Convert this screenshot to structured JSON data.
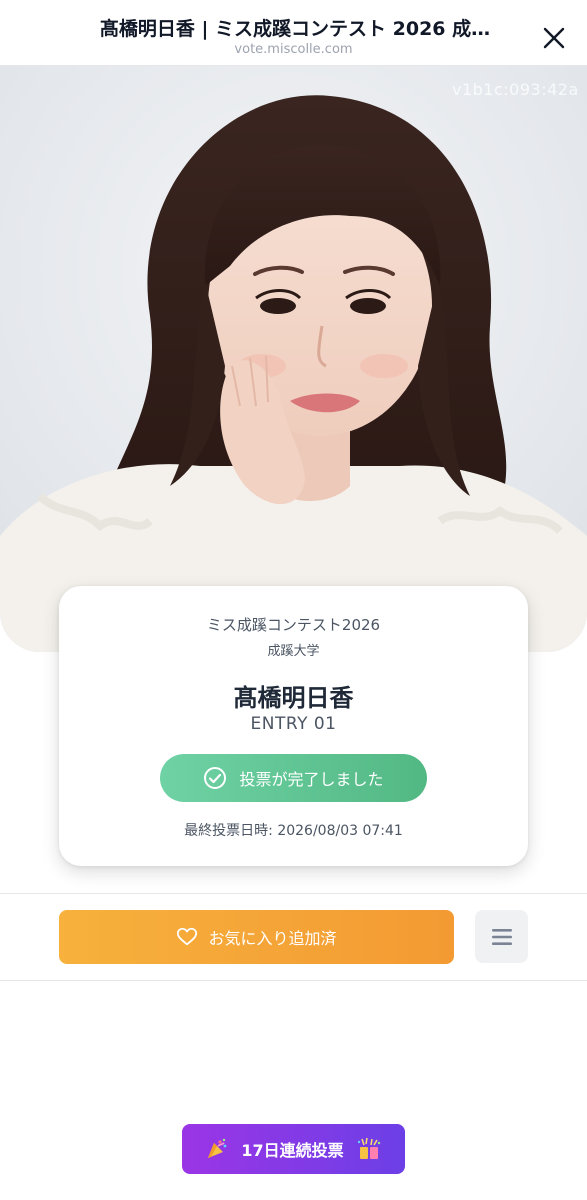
{
  "header": {
    "title": "髙橋明日香 | ミス成蹊コンテスト 2026 成…",
    "url": "vote.miscolle.com",
    "close_icon": "close-icon"
  },
  "hero": {
    "watermark": "v1b1c:093:42a"
  },
  "card": {
    "contest": "ミス成蹊コンテスト2026",
    "university": "成蹊大学",
    "name": "髙橋明日香",
    "entry": "ENTRY 01",
    "vote_status": "投票が完了しました",
    "vote_icon": "check-circle-icon",
    "last_vote": "最終投票日時: 2026/08/03 07:41"
  },
  "actions": {
    "favorite_label": "お気に入り追加済",
    "favorite_icon": "heart-icon",
    "menu_icon": "menu-icon"
  },
  "streak": {
    "label": "17日連続投票",
    "left_icon": "party-popper-icon",
    "right_icon": "celebration-icon"
  },
  "colors": {
    "vote_green": "#5cc493",
    "favorite_orange": "#f5a637",
    "streak_purple": "#8a3ae6"
  }
}
